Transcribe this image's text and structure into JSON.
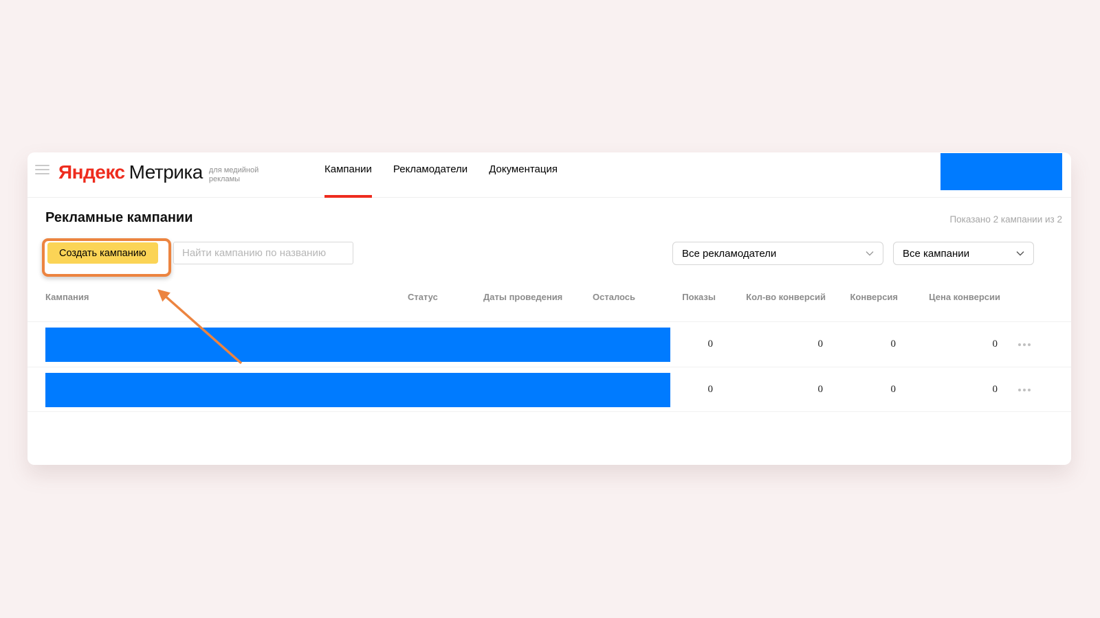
{
  "colors": {
    "page-bg": "#f9f1f1",
    "accent-red": "#ee2c1e",
    "redaction-blue": "#007bff",
    "annotation-orange": "#ec8440",
    "button-yellow": "#fbd456"
  },
  "header": {
    "logo_brand": "Яндекс",
    "logo_product": "Метрика",
    "logo_tagline": "для медийной рекламы",
    "nav": [
      {
        "label": "Кампании",
        "active": true
      },
      {
        "label": "Рекламодатели",
        "active": false
      },
      {
        "label": "Документация",
        "active": false
      }
    ]
  },
  "page_header": {
    "title": "Рекламные кампании",
    "results_summary": "Показано 2 кампании из 2"
  },
  "toolbar": {
    "create_button_label": "Создать кампанию",
    "search_placeholder": "Найти кампанию по названию",
    "advertiser_filter_value": "Все рекламодатели",
    "campaign_filter_value": "Все кампании"
  },
  "table": {
    "columns": [
      "Кампания",
      "Статус",
      "Даты проведения",
      "Осталось",
      "Показы",
      "Кол-во конверсий",
      "Конверсия",
      "Цена конверсии"
    ],
    "rows": [
      {
        "shows": "0",
        "conversions_count": "0",
        "conversion_rate": "0",
        "conversion_price": "0"
      },
      {
        "shows": "0",
        "conversions_count": "0",
        "conversion_rate": "0",
        "conversion_price": "0"
      }
    ]
  }
}
